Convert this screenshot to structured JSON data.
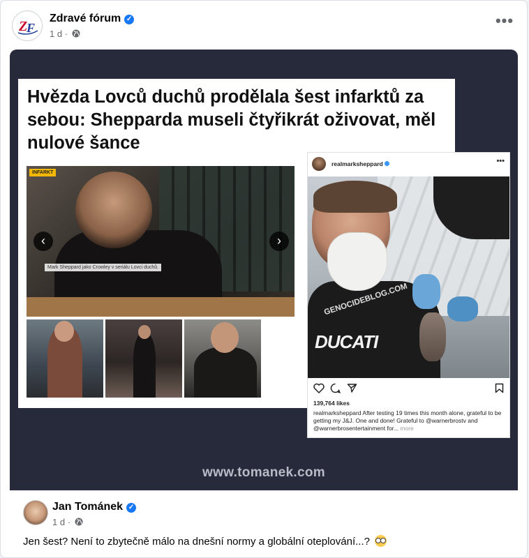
{
  "post": {
    "page_name": "Zdravé fórum",
    "time": "1 d",
    "separator": "·",
    "more_label": "•••"
  },
  "image": {
    "headline": "Hvězda Lovců duchů prodělala šest infarktů za sebou: Shepparda museli čtyřikrát oživovat, měl nulové šance",
    "hero_tag": "INFARKT",
    "hero_caption": "Mark Sheppard jako Crowley v seriálu Lovci duchů.",
    "arrow_left": "‹",
    "arrow_right": "›",
    "instagram": {
      "username": "realmarksheppard",
      "more": "•••",
      "shirt_text": "DUCATI",
      "watermark": "GENOCIDEBLOG.COM",
      "likes": "139,764 likes",
      "caption_user": "realmarksheppard",
      "caption_text": " After testing 19 times this month alone, grateful to be getting my J&J. One and done! Grateful to @warnerbrostv and @warnerbrosentertainment  for...",
      "caption_more": " more"
    },
    "site_url": "www.tomanek.com"
  },
  "comment": {
    "author": "Jan Tománek",
    "time": "1 d",
    "separator": "·",
    "text": "Jen šest? Není to zbytečně málo na dnešní normy a globální oteplování...?"
  },
  "icons": {
    "verified": "verified-badge-icon",
    "globe": "globe-icon",
    "emoji": "nerd-face-emoji-icon"
  },
  "colors": {
    "verified_blue": "#1877f2",
    "meta_gray": "#65676b",
    "image_bg": "#262a3b"
  }
}
